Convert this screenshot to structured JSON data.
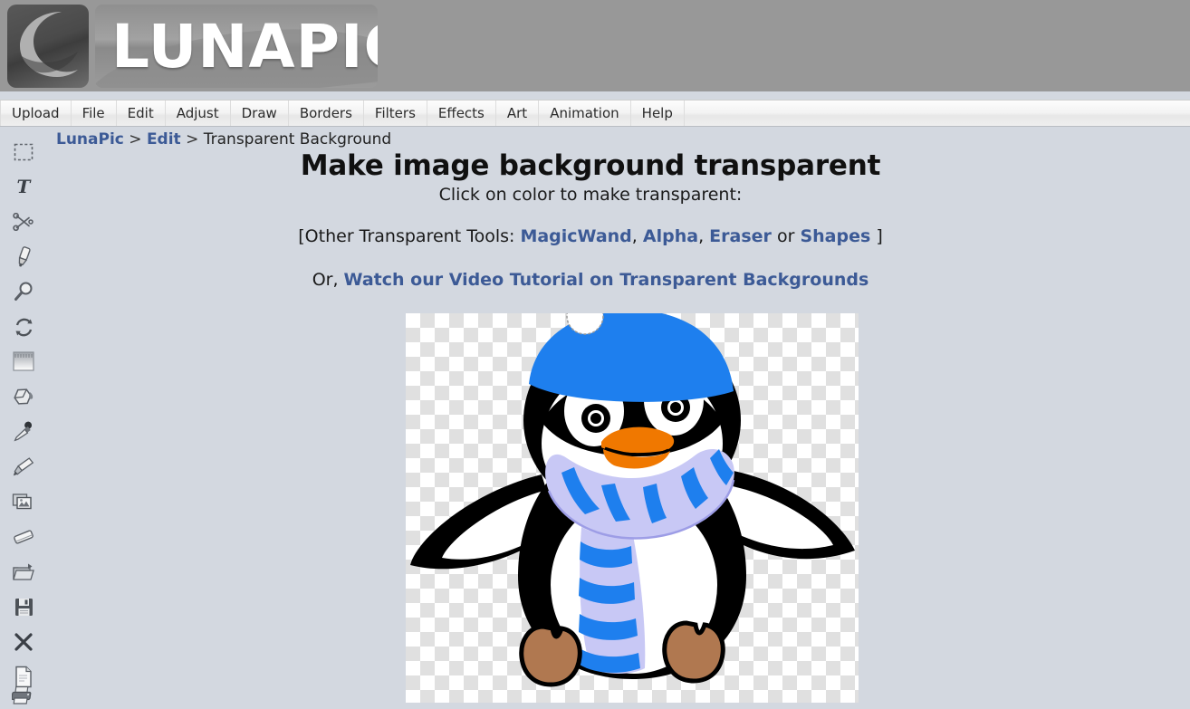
{
  "header": {
    "logo_text": "LUNAPIC",
    "logo_icon": "crescent-moon-icon"
  },
  "menubar": {
    "items": [
      {
        "label": "Upload",
        "name": "menu-upload"
      },
      {
        "label": "File",
        "name": "menu-file"
      },
      {
        "label": "Edit",
        "name": "menu-edit"
      },
      {
        "label": "Adjust",
        "name": "menu-adjust"
      },
      {
        "label": "Draw",
        "name": "menu-draw"
      },
      {
        "label": "Borders",
        "name": "menu-borders"
      },
      {
        "label": "Filters",
        "name": "menu-filters"
      },
      {
        "label": "Effects",
        "name": "menu-effects"
      },
      {
        "label": "Art",
        "name": "menu-art"
      },
      {
        "label": "Animation",
        "name": "menu-animation"
      },
      {
        "label": "Help",
        "name": "menu-help"
      }
    ]
  },
  "sidebar": {
    "tools": [
      {
        "name": "selection-marquee-icon",
        "title": "Select"
      },
      {
        "name": "text-tool-icon",
        "title": "Text"
      },
      {
        "name": "scissors-icon",
        "title": "Cut"
      },
      {
        "name": "marker-pen-icon",
        "title": "Marker"
      },
      {
        "name": "magnifier-icon",
        "title": "Zoom"
      },
      {
        "name": "rotate-icon",
        "title": "Rotate"
      },
      {
        "name": "gradient-icon",
        "title": "Gradient"
      },
      {
        "name": "paint-bucket-icon",
        "title": "Fill"
      },
      {
        "name": "eyedropper-icon",
        "title": "Color Picker"
      },
      {
        "name": "paintbrush-icon",
        "title": "Brush"
      },
      {
        "name": "copy-images-icon",
        "title": "Copy"
      },
      {
        "name": "eraser-icon",
        "title": "Eraser"
      },
      {
        "name": "open-folder-icon",
        "title": "Open"
      },
      {
        "name": "save-floppy-icon",
        "title": "Save"
      },
      {
        "name": "close-x-icon",
        "title": "Close"
      },
      {
        "name": "new-document-icon",
        "title": "New"
      },
      {
        "name": "printer-icon",
        "title": "Print"
      }
    ]
  },
  "breadcrumb": {
    "root": "LunaPic",
    "section": "Edit",
    "current": "Transparent Background",
    "separator": ">"
  },
  "main": {
    "heading": "Make image background transparent",
    "subheading": "Click on color to make transparent:",
    "tools_prefix": "[Other Transparent Tools:",
    "tools_links": [
      {
        "label": "MagicWand",
        "name": "link-magicwand"
      },
      {
        "label": "Alpha",
        "name": "link-alpha"
      },
      {
        "label": "Eraser",
        "name": "link-eraser"
      },
      {
        "label": "Shapes",
        "name": "link-shapes"
      }
    ],
    "tools_comma": ",",
    "tools_or": "or",
    "tools_suffix": "]",
    "video_prefix": "Or,",
    "video_link": "Watch our Video Tutorial on Transparent Backgrounds"
  },
  "canvas": {
    "alt": "penguin-with-blue-hat-and-striped-scarf",
    "checker_light": "#ffffff",
    "checker_dark": "#e0e0e0"
  },
  "colors": {
    "page_background": "#d3d8e0",
    "header_gray": "#989898",
    "link_blue": "#3c5a96",
    "hat_blue": "#1e7fee",
    "scarf_lavender": "#c8c8f5",
    "beak_orange": "#f07800",
    "feet_brown": "#b07850",
    "body_black": "#000000",
    "belly_white": "#ffffff"
  }
}
